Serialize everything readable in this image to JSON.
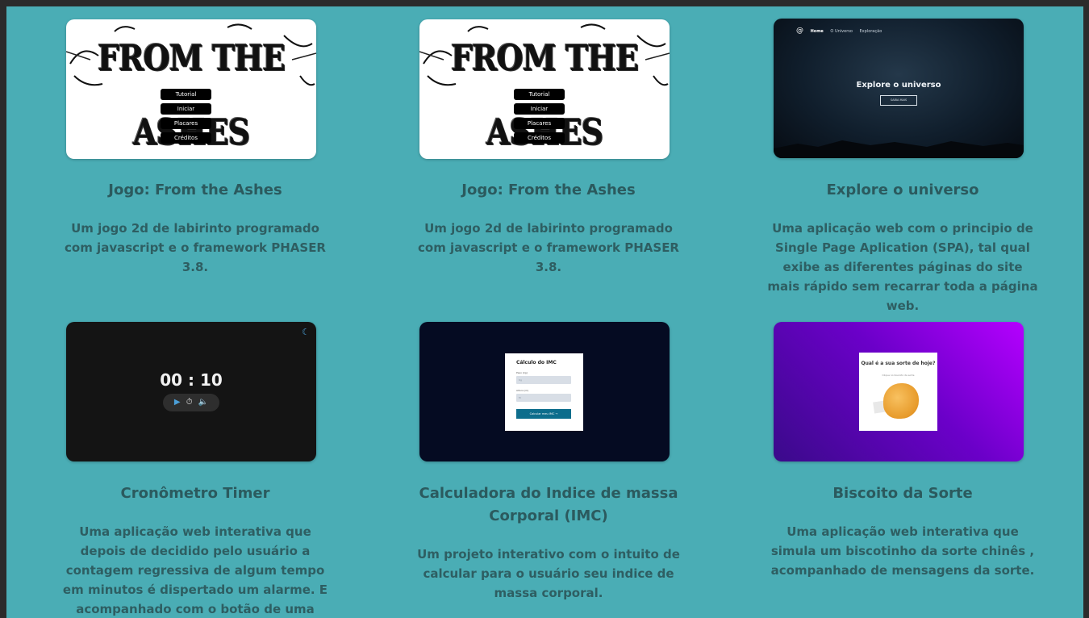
{
  "projects": [
    {
      "title": "Jogo: From the Ashes",
      "description": "Um jogo 2d de labirinto programado com javascript e o framework PHASER 3.8.",
      "thumb": {
        "logo": "FROM THE ASHES",
        "menu": [
          "Tutorial",
          "Iniciar",
          "Placares",
          "Créditos"
        ]
      }
    },
    {
      "title": "Jogo: From the Ashes",
      "description": "Um jogo 2d de labirinto programado com javascript e o framework PHASER 3.8.",
      "thumb": {
        "logo": "FROM THE ASHES",
        "menu": [
          "Tutorial",
          "Iniciar",
          "Placares",
          "Créditos"
        ]
      }
    },
    {
      "title": "Explore o universo",
      "description": "Uma aplicação web com o principio de Single Page Aplication (SPA), tal qual exibe as diferentes páginas do site mais rápido sem recarrar toda a página web.",
      "thumb": {
        "nav": [
          "Home",
          "O Universo",
          "Exploração"
        ],
        "headline": "Explore o universo",
        "button": "SAIBA MAIS"
      }
    },
    {
      "title": "Cronômetro Timer",
      "description": "Uma aplicação web interativa que depois de decidido pelo usuário a contagem regressiva de algum tempo em minutos é dispertado um alarme. E acompanhado com o botão de uma musica de fundo.",
      "thumb": {
        "time": "00 : 10"
      }
    },
    {
      "title": "Calculadora do Indice de massa Corporal (IMC)",
      "description": "Um projeto interativo com o intuito de calcular para o usuário seu indice de massa corporal.",
      "thumb": {
        "heading": "Cálculo do IMC",
        "label1": "Peso (kg)",
        "label2": "Altura (m)",
        "placeholder1": "Kg",
        "placeholder2": "M",
        "button": "Calcular meu IMC →"
      }
    },
    {
      "title": "Biscoito da Sorte",
      "description": "Uma aplicação web interativa que simula um biscotinho da sorte chinês , acompanhado de mensagens da sorte.",
      "thumb": {
        "question": "Qual é a sua sorte de hoje?",
        "hint": "Clique no biscoito da sorte"
      }
    }
  ],
  "colors": {
    "background": "#4aadb5",
    "text": "#2b5a5e",
    "frame": "#2b2b2b"
  }
}
